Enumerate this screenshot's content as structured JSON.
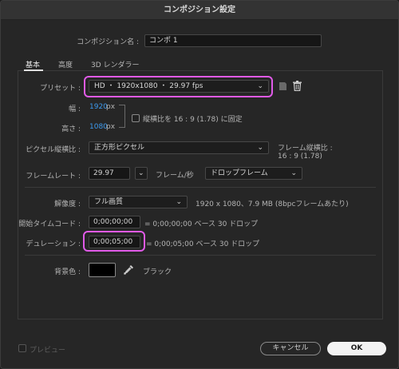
{
  "dialog": {
    "title": "コンポジション設定"
  },
  "comp_name": {
    "label": "コンポジション名 :",
    "value": "コンポ 1"
  },
  "tabs": [
    {
      "label": "基本",
      "active": true
    },
    {
      "label": "高度",
      "active": false
    },
    {
      "label": "3D レンダラー",
      "active": false
    }
  ],
  "preset": {
    "label": "プリセット :",
    "value": "HD ・ 1920x1080 ・ 29.97 fps"
  },
  "width": {
    "label": "幅 :",
    "value": "1920",
    "unit": "px"
  },
  "height": {
    "label": "高さ :",
    "value": "1080",
    "unit": "px"
  },
  "aspect_lock": {
    "label": "縦横比を 16 : 9 (1.78) に固定",
    "checked": false
  },
  "pixel_aspect": {
    "label": "ピクセル縦横比 :",
    "value": "正方形ピクセル"
  },
  "frame_aspect": {
    "label": "フレーム縦横比 :",
    "value": "16 : 9 (1.78)"
  },
  "frame_rate": {
    "label": "フレームレート :",
    "value": "29.97",
    "unit_label": "フレーム/秒",
    "mode": "ドロップフレーム"
  },
  "resolution": {
    "label": "解像度 :",
    "value": "フル画質",
    "info": "1920 x 1080、7.9 MB (8bpcフレームあたり)"
  },
  "start_timecode": {
    "label": "開始タイムコード :",
    "value": "0;00;00;00",
    "info": "= 0;00;00;00  ベース 30   ドロップ"
  },
  "duration": {
    "label": "デュレーション :",
    "value": "0;00;05;00",
    "info": "= 0;00;05;00  ベース 30   ドロップ"
  },
  "background": {
    "label": "背景色 :",
    "color_name": "ブラック",
    "color": "#000000"
  },
  "preview": {
    "label": "プレビュー",
    "checked": false
  },
  "buttons": {
    "cancel": "キャンセル",
    "ok": "OK"
  },
  "highlight_color": "#e05ae8",
  "link_color": "#3d9aee"
}
